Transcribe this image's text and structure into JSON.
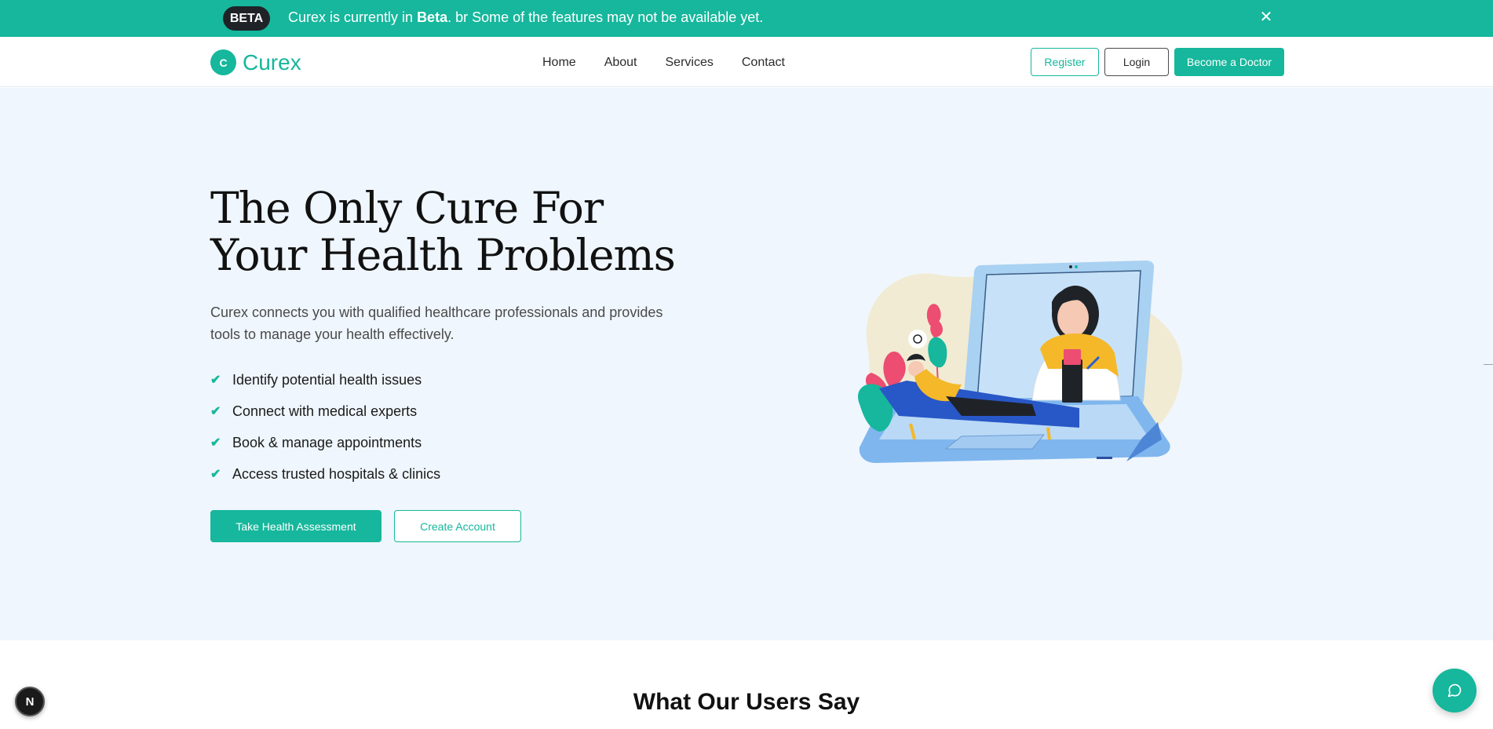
{
  "banner": {
    "badge": "BETA",
    "text_before": "Curex is currently in ",
    "text_bold": "Beta",
    "text_after": ". br Some of the features may not be available yet.",
    "close_icon": "close-icon"
  },
  "navbar": {
    "logo_letter": "C",
    "logo_text": "Curex",
    "links": [
      "Home",
      "About",
      "Services",
      "Contact"
    ],
    "register_label": "Register",
    "login_label": "Login",
    "doctor_label": "Become a Doctor"
  },
  "hero": {
    "title_line1": "The Only Cure For",
    "title_line2": "Your Health Problems",
    "subtitle": "Curex connects you with qualified healthcare professionals and provides tools to manage your health effectively.",
    "features": [
      "Identify potential health issues",
      "Connect with medical experts",
      "Book & manage appointments",
      "Access trusted hospitals & clinics"
    ],
    "primary_cta": "Take Health Assessment",
    "secondary_cta": "Create Account"
  },
  "testimonials": {
    "title": "What Our Users Say"
  },
  "floating": {
    "next_letter": "N",
    "chat_icon": "chat-icon"
  },
  "colors": {
    "brand": "#16b79c",
    "hero_bg": "#eff6fd"
  }
}
